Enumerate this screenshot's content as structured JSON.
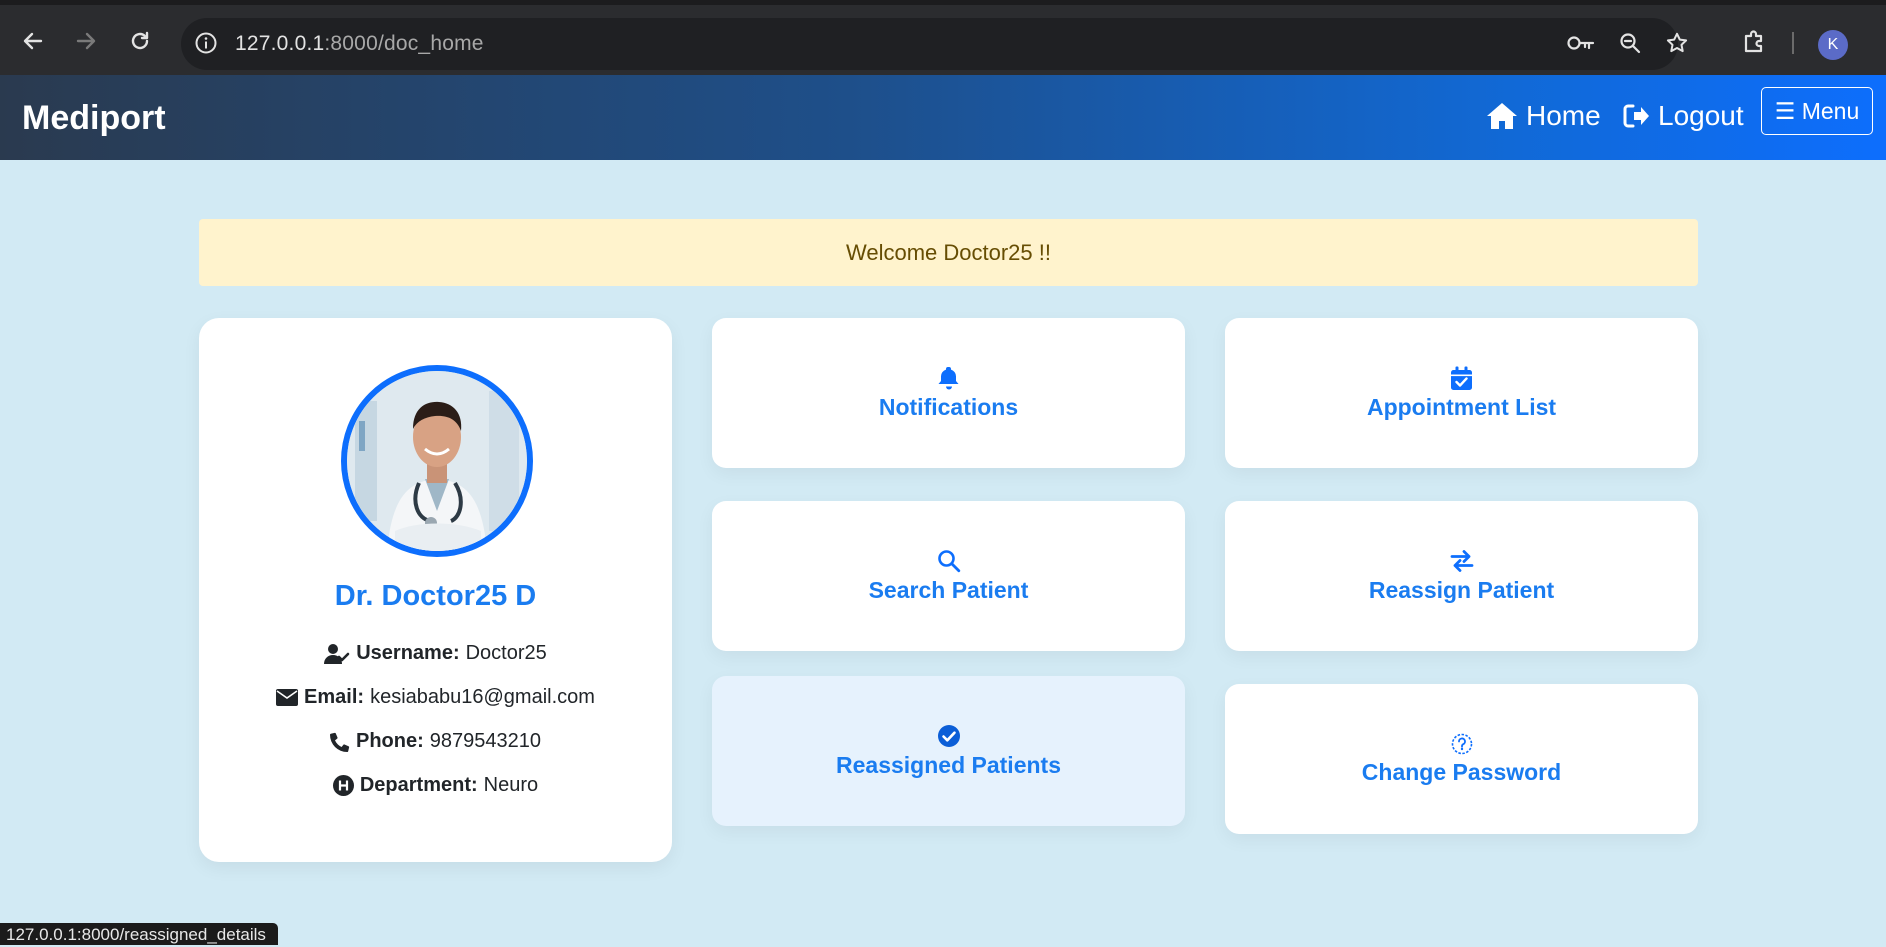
{
  "browser": {
    "url_host": "127.0.0.1",
    "url_rest": ":8000/doc_home",
    "profile_initial": "K"
  },
  "navbar": {
    "brand": "Mediport",
    "home_label": "Home",
    "logout_label": "Logout",
    "menu_label": "☰ Menu"
  },
  "alert": {
    "text": "Welcome Doctor25 !!"
  },
  "profile": {
    "name": "Dr. Doctor25 D",
    "username_label": "Username:",
    "username": "Doctor25",
    "email_label": "Email:",
    "email": "kesiababu16@gmail.com",
    "phone_label": "Phone:",
    "phone": "9879543210",
    "department_label": "Department:",
    "department": "Neuro"
  },
  "tiles": [
    {
      "label": "Notifications",
      "icon": "bell-icon"
    },
    {
      "label": "Appointment List",
      "icon": "calendar-check-icon"
    },
    {
      "label": "Search Patient",
      "icon": "search-icon"
    },
    {
      "label": "Reassign Patient",
      "icon": "arrows-exchange-icon"
    },
    {
      "label": "Reassigned Patients",
      "icon": "check-circle-icon"
    },
    {
      "label": "Change Password",
      "icon": "question-circle-icon"
    }
  ],
  "status_bar": {
    "text": "127.0.0.1:8000/reassigned_details"
  },
  "colors": {
    "accent": "#0d6efd",
    "link_text": "#1a7cf0",
    "page_bg": "#d2eaf4",
    "alert_bg": "#fff3cd",
    "alert_text": "#664d03"
  }
}
